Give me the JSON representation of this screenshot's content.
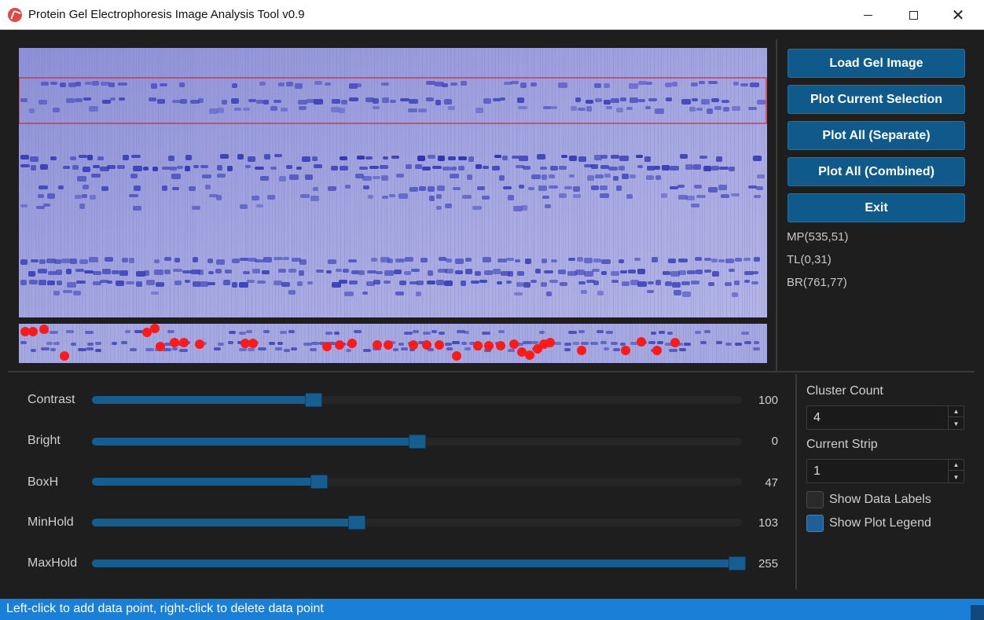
{
  "window": {
    "title": "Protein Gel Electrophoresis Image Analysis Tool v0.9",
    "icon": "app-logo-icon"
  },
  "colors": {
    "button": "#0f5a8a",
    "slider_fill": "#175e90",
    "status_bar": "#1a7fd6",
    "selection_box": "#e02020",
    "data_point": "#ff1a1a"
  },
  "buttons": {
    "load": "Load Gel Image",
    "plot_current": "Plot Current Selection",
    "plot_separate": "Plot All (Separate)",
    "plot_combined": "Plot All (Combined)",
    "exit": "Exit"
  },
  "coordinates": {
    "mp": "MP(535,51)",
    "tl": "TL(0,31)",
    "br": "BR(761,77)"
  },
  "sliders": [
    {
      "label": "Contrast",
      "value": "100",
      "fraction": 0.339
    },
    {
      "label": "Bright",
      "value": "0",
      "fraction": 0.5
    },
    {
      "label": "BoxH",
      "value": "47",
      "fraction": 0.347
    },
    {
      "label": "MinHold",
      "value": "103",
      "fraction": 0.406
    },
    {
      "label": "MaxHold",
      "value": "255",
      "fraction": 1.0
    }
  ],
  "settings": {
    "cluster_count_label": "Cluster Count",
    "cluster_count_value": "4",
    "current_strip_label": "Current Strip",
    "current_strip_value": "1",
    "show_data_labels": {
      "label": "Show Data Labels",
      "checked": false
    },
    "show_plot_legend": {
      "label": "Show Plot Legend",
      "checked": true
    }
  },
  "status": {
    "text": "Left-click to add data point, right-click to delete data point"
  }
}
